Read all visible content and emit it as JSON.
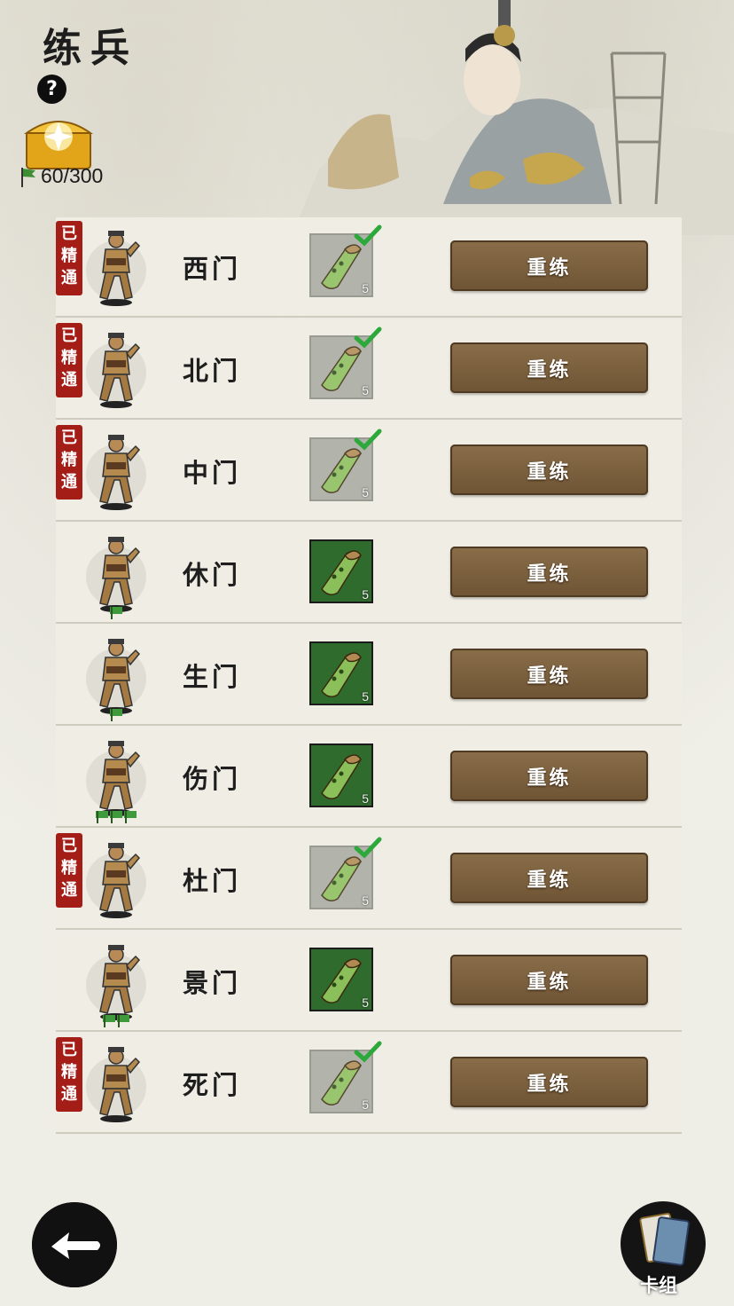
{
  "header": {
    "title": "练兵",
    "help_label": "?",
    "counter": "60/300"
  },
  "badge_text": [
    "已",
    "精",
    "通"
  ],
  "rows": [
    {
      "name": "西门",
      "mastered": true,
      "scroll_level": "5",
      "button": "重练",
      "pedestal": 0
    },
    {
      "name": "北门",
      "mastered": true,
      "scroll_level": "5",
      "button": "重练",
      "pedestal": 0
    },
    {
      "name": "中门",
      "mastered": true,
      "scroll_level": "5",
      "button": "重练",
      "pedestal": 0
    },
    {
      "name": "休门",
      "mastered": false,
      "scroll_level": "5",
      "button": "重练",
      "pedestal": 1
    },
    {
      "name": "生门",
      "mastered": false,
      "scroll_level": "5",
      "button": "重练",
      "pedestal": 1
    },
    {
      "name": "伤门",
      "mastered": false,
      "scroll_level": "5",
      "button": "重练",
      "pedestal": 3
    },
    {
      "name": "杜门",
      "mastered": true,
      "scroll_level": "5",
      "button": "重练",
      "pedestal": 0
    },
    {
      "name": "景门",
      "mastered": false,
      "scroll_level": "5",
      "button": "重练",
      "pedestal": 2
    },
    {
      "name": "死门",
      "mastered": true,
      "scroll_level": "5",
      "button": "重练",
      "pedestal": 0
    }
  ],
  "footer": {
    "deck_label": "卡组"
  },
  "colors": {
    "button": "#7d6342",
    "badge": "#a51d17",
    "scroll_green": "#2f6b2c"
  }
}
